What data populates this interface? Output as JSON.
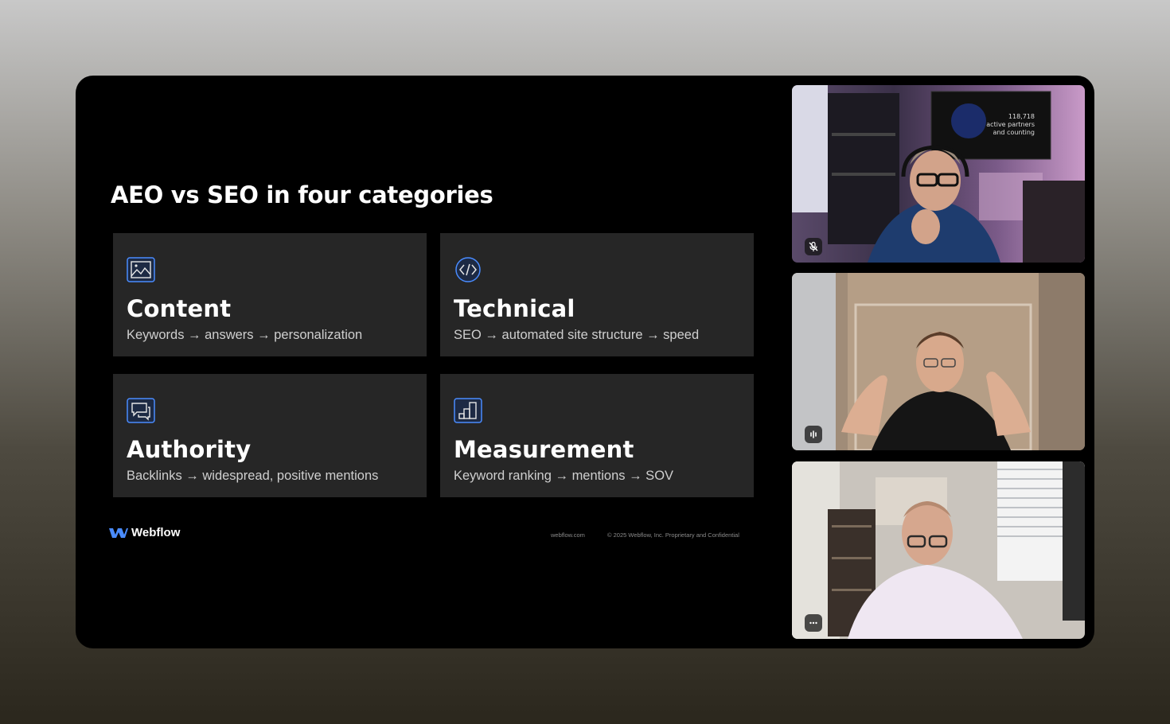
{
  "slide": {
    "title": "AEO vs SEO in four categories",
    "cards": [
      {
        "icon": "image-icon",
        "title": "Content",
        "subtitle": "Keywords → answers → personalization"
      },
      {
        "icon": "code-icon",
        "title": "Technical",
        "subtitle": "SEO → automated site structure → speed"
      },
      {
        "icon": "chat-bubbles-icon",
        "title": "Authority",
        "subtitle": "Backlinks → widespread, positive mentions"
      },
      {
        "icon": "bar-chart-icon",
        "title": "Measurement",
        "subtitle": "Keyword ranking → mentions → SOV"
      }
    ],
    "brand": "Webflow",
    "footer_site": "webflow.com",
    "footer_legal": "© 2025 Webflow, Inc. Proprietary and Confidential"
  },
  "participants": [
    {
      "tile": "participant-1",
      "status_icon": "mic-muted-icon",
      "screen_text": [
        "118,718",
        "active partners",
        "and counting"
      ]
    },
    {
      "tile": "participant-2",
      "status_icon": "speaking-indicator-icon"
    },
    {
      "tile": "participant-3",
      "status_icon": "more-options-icon"
    }
  ],
  "colors": {
    "accent": "#4a8cff",
    "card_bg": "#262626",
    "slide_bg": "#000000"
  }
}
